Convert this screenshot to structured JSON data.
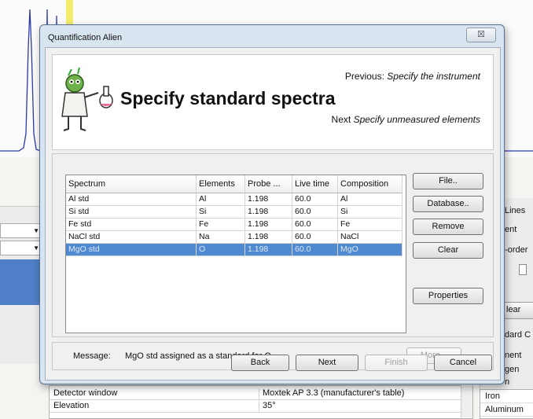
{
  "dialog": {
    "title": "Quantification Alien",
    "close_glyph": "☒",
    "previous_label": "Previous:",
    "previous_step": "Specify the instrument",
    "heading": "Specify standard spectra",
    "next_label": "Next",
    "next_step": "Specify unmeasured elements"
  },
  "table": {
    "columns": [
      "Spectrum",
      "Elements",
      "Probe ...",
      "Live time",
      "Composition"
    ],
    "rows": [
      [
        "Al std",
        "Al",
        "1.198",
        "60.0",
        "Al"
      ],
      [
        "Si std",
        "Si",
        "1.198",
        "60.0",
        "Si"
      ],
      [
        "Fe std",
        "Fe",
        "1.198",
        "60.0",
        "Fe"
      ],
      [
        "NaCl std",
        "Na",
        "1.198",
        "60.0",
        "NaCl"
      ],
      [
        "MgO std",
        "O",
        "1.198",
        "60.0",
        "MgO"
      ]
    ],
    "selected_row": 4
  },
  "side_buttons": {
    "file": "File..",
    "database": "Database..",
    "remove": "Remove",
    "clear": "Clear",
    "properties": "Properties"
  },
  "message": {
    "label": "Message:",
    "text": "MgO std assigned as a standard for O",
    "more": "More..."
  },
  "nav": {
    "back": "Back",
    "next": "Next",
    "finish": "Finish",
    "cancel": "Cancel"
  },
  "background": {
    "right_labels": [
      "Lines",
      "ent",
      "2-order",
      "lear",
      "dard C",
      "nent",
      "gen",
      "n"
    ],
    "right_list": [
      "Iron",
      "Aluminum"
    ],
    "properties": [
      {
        "key": "Detector window",
        "value": "Moxtek AP 3.3 (manufacturer's table)"
      },
      {
        "key": "Elevation",
        "value": "35°"
      }
    ]
  },
  "colors": {
    "selection": "#4f8ad0",
    "dialog_frame": "#d9e4f1",
    "plot_line": "#2a3aa8",
    "plot_marker": "#f3ec6a"
  }
}
